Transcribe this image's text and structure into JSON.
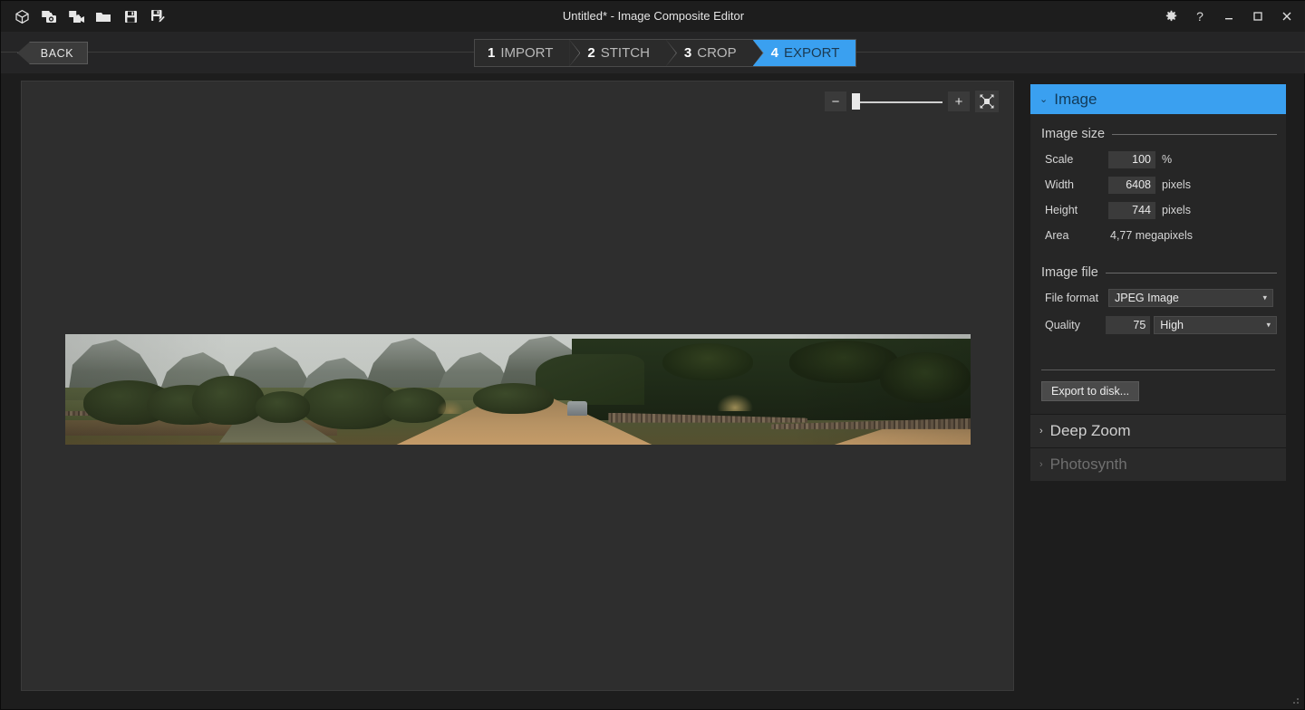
{
  "window": {
    "title": "Untitled* - Image Composite Editor",
    "controls": {
      "settings": "gear-icon",
      "help": "?",
      "minimize": "—",
      "maximize": "☐",
      "close": "✕"
    }
  },
  "toolbar": {
    "items": [
      {
        "name": "new-panorama-icon",
        "tip": "New panorama"
      },
      {
        "name": "add-images-icon",
        "tip": "Add images"
      },
      {
        "name": "add-video-icon",
        "tip": "Add video"
      },
      {
        "name": "open-icon",
        "tip": "Open"
      },
      {
        "name": "save-icon",
        "tip": "Save"
      },
      {
        "name": "save-as-icon",
        "tip": "Save as"
      }
    ]
  },
  "wizard": {
    "back_label": "BACK",
    "steps": [
      {
        "num": "1",
        "label": "IMPORT",
        "active": false
      },
      {
        "num": "2",
        "label": "STITCH",
        "active": false
      },
      {
        "num": "3",
        "label": "CROP",
        "active": false
      },
      {
        "num": "4",
        "label": "EXPORT",
        "active": true
      }
    ]
  },
  "canvas": {
    "zoom": {
      "minus_label": "−",
      "plus_label": "+",
      "fit_icon": "fit-to-window-icon",
      "value": 8
    }
  },
  "panel": {
    "header": {
      "title": "Image",
      "caret": "⌄"
    },
    "image_size": {
      "title": "Image size",
      "scale": {
        "label": "Scale",
        "value": "100",
        "unit": "%"
      },
      "width": {
        "label": "Width",
        "value": "6408",
        "unit": "pixels"
      },
      "height": {
        "label": "Height",
        "value": "744",
        "unit": "pixels"
      },
      "area": {
        "label": "Area",
        "value": "4,77 megapixels"
      }
    },
    "image_file": {
      "title": "Image file",
      "file_format": {
        "label": "File format",
        "value": "JPEG Image"
      },
      "quality": {
        "label": "Quality",
        "value": "75",
        "preset": "High"
      }
    },
    "export_button": "Export to disk...",
    "sections": [
      {
        "label": "Deep Zoom",
        "caret": "›",
        "disabled": false
      },
      {
        "label": "Photosynth",
        "caret": "›",
        "disabled": true
      }
    ]
  },
  "colors": {
    "accent": "#3aa0f0",
    "window_bg": "#1d1d1d",
    "panel_bg": "#262626",
    "canvas_bg": "#2e2e2e"
  }
}
